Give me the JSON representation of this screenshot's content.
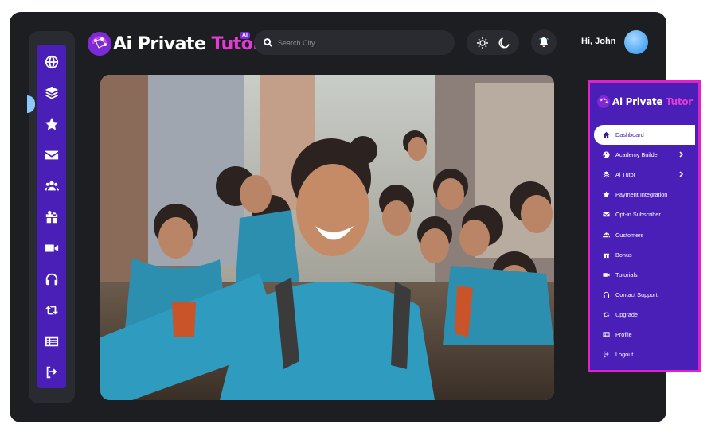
{
  "app": {
    "logo_white": "Ai Private ",
    "logo_pink": "Tutor",
    "logo_badge": "AI"
  },
  "search": {
    "placeholder": "Search City..."
  },
  "header": {
    "greeting": "Hi, John",
    "theme_icons": [
      "sun-icon",
      "moon-icon"
    ],
    "notification_icon": "bell-icon"
  },
  "rail": {
    "icons": [
      "globe-icon",
      "layers-icon",
      "star-icon",
      "envelope-icon",
      "users-icon",
      "gift-icon",
      "video-icon",
      "headphones-icon",
      "retweet-icon",
      "list-card-icon",
      "sign-out-icon"
    ]
  },
  "side_menu": {
    "logo_white": "Ai Private ",
    "logo_pink": "Tutor",
    "items": [
      {
        "label": "Dashboard",
        "icon": "home-icon",
        "active": true
      },
      {
        "label": "Academy Builder",
        "icon": "globe-icon",
        "submenu": true
      },
      {
        "label": "Ai Tutor",
        "icon": "layers-icon",
        "submenu": true
      },
      {
        "label": "Payment Integration",
        "icon": "star-icon"
      },
      {
        "label": "Opt-in Subscriber",
        "icon": "envelope-icon"
      },
      {
        "label": "Customers",
        "icon": "users-icon"
      },
      {
        "label": "Bonus",
        "icon": "gift-icon"
      },
      {
        "label": "Tutorials",
        "icon": "video-icon"
      },
      {
        "label": "Contact Support",
        "icon": "headphones-icon"
      },
      {
        "label": "Upgrade",
        "icon": "retweet-icon"
      },
      {
        "label": "Profile",
        "icon": "list-card-icon"
      },
      {
        "label": "Logout",
        "icon": "sign-out-icon"
      }
    ]
  },
  "colors": {
    "frame_bg": "#1d1e22",
    "accent_purple": "#4a1fb8",
    "accent_pink": "#e23bd6",
    "side_border": "#e020c8"
  }
}
